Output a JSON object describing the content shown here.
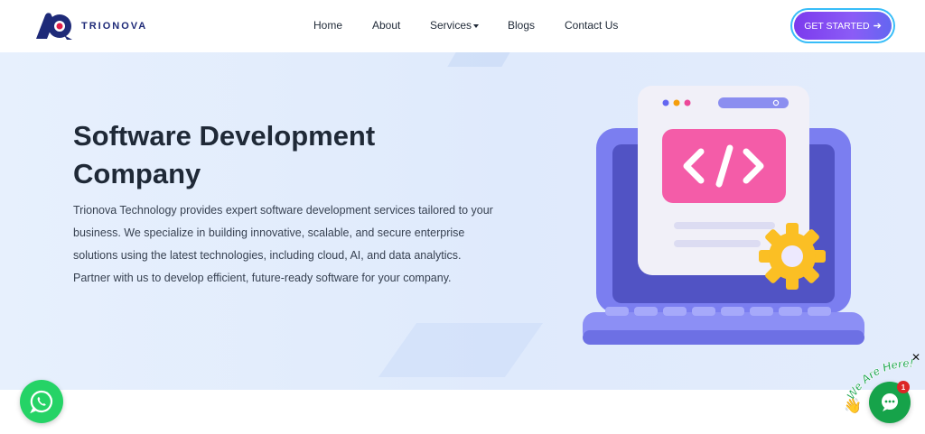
{
  "brand": {
    "name": "TRIONOVA",
    "primary_color": "#1e2a78",
    "accent_color": "#e11d48"
  },
  "nav": {
    "items": [
      {
        "label": "Home"
      },
      {
        "label": "About"
      },
      {
        "label": "Services"
      },
      {
        "label": "Blogs"
      },
      {
        "label": "Contact Us"
      }
    ],
    "cta_label": "GET STARTED",
    "cta_icon": "arrow-right-icon"
  },
  "hero": {
    "title_line1": "Software Development",
    "title_line2": "Company",
    "description": "Trionova Technology provides expert software development services tailored to your business. We specialize in building innovative, scalable, and secure enterprise solutions using the latest technologies, including cloud, AI, and data analytics. Partner with us to develop efficient, future-ready software for your company.",
    "illustration_icon": "laptop-code-icon",
    "code_symbol": "</>"
  },
  "widgets": {
    "whatsapp_icon": "whatsapp-icon",
    "chat_tagline": "We Are Here!",
    "chat_badge_count": "1",
    "chat_close": "✕",
    "wave_emoji": "👋"
  },
  "colors": {
    "hero_bg": "#e3ecfc",
    "cta_gradient_start": "#7c3aed",
    "whatsapp_green": "#25d366",
    "chat_green": "#16a34a",
    "code_panel_pink": "#f45ca8",
    "gear_yellow": "#fbbf24",
    "laptop_purple": "#7b7ef0"
  }
}
